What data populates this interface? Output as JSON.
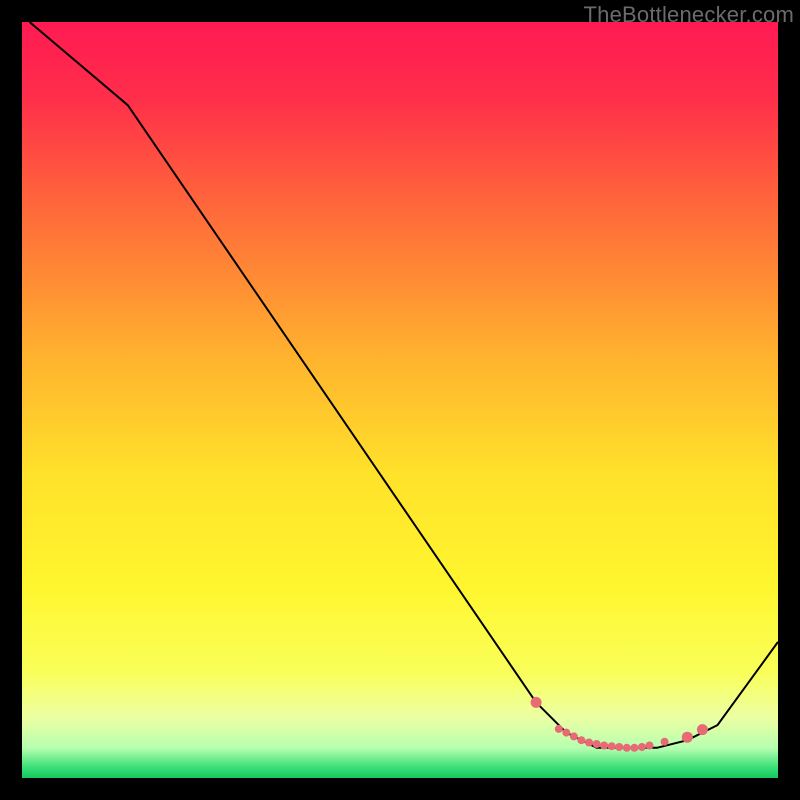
{
  "attribution": "TheBottlenecker.com",
  "chart_data": {
    "type": "line",
    "title": "",
    "xlabel": "",
    "ylabel": "",
    "xlim": [
      0,
      100
    ],
    "ylim": [
      0,
      100
    ],
    "series": [
      {
        "name": "curve",
        "color": "#000000",
        "x": [
          1,
          14,
          68,
          72,
          76,
          80,
          84,
          88,
          92,
          100
        ],
        "y": [
          100,
          89,
          10,
          6,
          4,
          4,
          4,
          5,
          7,
          18
        ]
      },
      {
        "name": "markers",
        "color": "#e86a74",
        "x": [
          68,
          71,
          72,
          73,
          74,
          75,
          76,
          77,
          78,
          79,
          80,
          81,
          82,
          83,
          85,
          88,
          90
        ],
        "y": [
          10,
          6.5,
          6,
          5.5,
          5,
          4.7,
          4.5,
          4.3,
          4.2,
          4.1,
          4.0,
          4.0,
          4.1,
          4.3,
          4.8,
          5.4,
          6.4
        ]
      }
    ],
    "background_gradient": {
      "stops": [
        {
          "offset": 0.0,
          "color": "#ff1a53"
        },
        {
          "offset": 0.1,
          "color": "#ff2e4a"
        },
        {
          "offset": 0.25,
          "color": "#ff6a3a"
        },
        {
          "offset": 0.45,
          "color": "#ffb52e"
        },
        {
          "offset": 0.6,
          "color": "#ffe22a"
        },
        {
          "offset": 0.75,
          "color": "#fff62f"
        },
        {
          "offset": 0.86,
          "color": "#f9ff59"
        },
        {
          "offset": 0.92,
          "color": "#ecffa3"
        },
        {
          "offset": 0.96,
          "color": "#b7ffb0"
        },
        {
          "offset": 0.985,
          "color": "#3fe07a"
        },
        {
          "offset": 1.0,
          "color": "#14c85e"
        }
      ]
    }
  }
}
